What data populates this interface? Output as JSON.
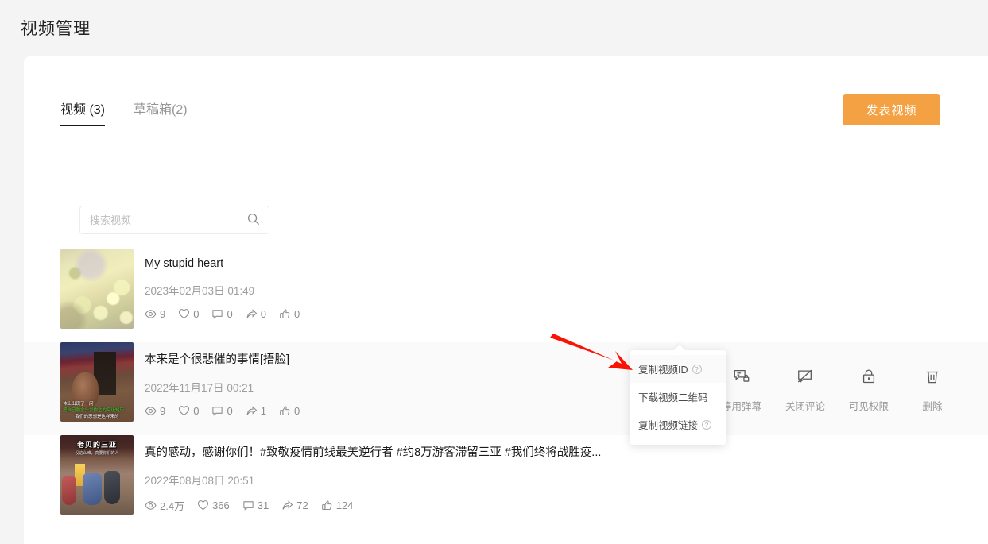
{
  "header": {
    "title": "视频管理"
  },
  "tabs": [
    {
      "label": "视频 (3)",
      "active": true
    },
    {
      "label": "草稿箱(2)",
      "active": false
    }
  ],
  "publish_button": {
    "label": "发表视频",
    "color": "#f4a143"
  },
  "search": {
    "placeholder": "搜索视频",
    "value": "",
    "icon": "search-icon"
  },
  "videos": [
    {
      "title": "My stupid heart",
      "date": "2023年02月03日 01:49",
      "stats": {
        "views": "9",
        "likes": "0",
        "comments": "0",
        "shares": "0",
        "thumbs": "0"
      },
      "thumbnail_overlay_title": "",
      "thumbnail_overlay_sub": "",
      "hovered": false
    },
    {
      "title": "本来是个很悲催的事情[捂脸]",
      "date": "2022年11月17日 00:21",
      "stats": {
        "views": "9",
        "likes": "0",
        "comments": "0",
        "shares": "1",
        "thumbs": "0"
      },
      "thumbnail_sub_line1": "休上出现了一闪",
      "thumbnail_sub_line2": "把自己和念头发作之的高级短历",
      "thumbnail_sub_line3": "我们的思想是这样来的",
      "hovered": true
    },
    {
      "title": "真的感动，感谢你们！#致敬疫情前线最美逆行者 #约8万游客滞留三亚 #我们终将战胜疫...",
      "date": "2022年08月08日 20:51",
      "stats": {
        "views": "2.4万",
        "likes": "366",
        "comments": "31",
        "shares": "72",
        "thumbs": "124"
      },
      "thumbnail_overlay_title": "老贝的三亚",
      "thumbnail_overlay_sub": "没这么难，真要你们的人",
      "hovered": false
    }
  ],
  "row_actions": [
    {
      "label": "",
      "icon": "more-dots-icon",
      "name": "more-actions"
    },
    {
      "label": "停用弹幕",
      "icon": "danmaku-lock-icon",
      "name": "disable-danmaku"
    },
    {
      "label": "关闭评论",
      "icon": "comment-off-icon",
      "name": "close-comments"
    },
    {
      "label": "可见权限",
      "icon": "lock-icon",
      "name": "visibility-permission"
    },
    {
      "label": "删除",
      "icon": "trash-icon",
      "name": "delete"
    }
  ],
  "dropdown": {
    "items": [
      {
        "label": "复制视频ID",
        "help": "?",
        "has_help": true
      },
      {
        "label": "下载视频二维码",
        "help": "",
        "has_help": false
      },
      {
        "label": "复制视频链接",
        "help": "?",
        "has_help": true
      }
    ]
  },
  "annotation": {
    "arrow_color": "#fb1203"
  }
}
